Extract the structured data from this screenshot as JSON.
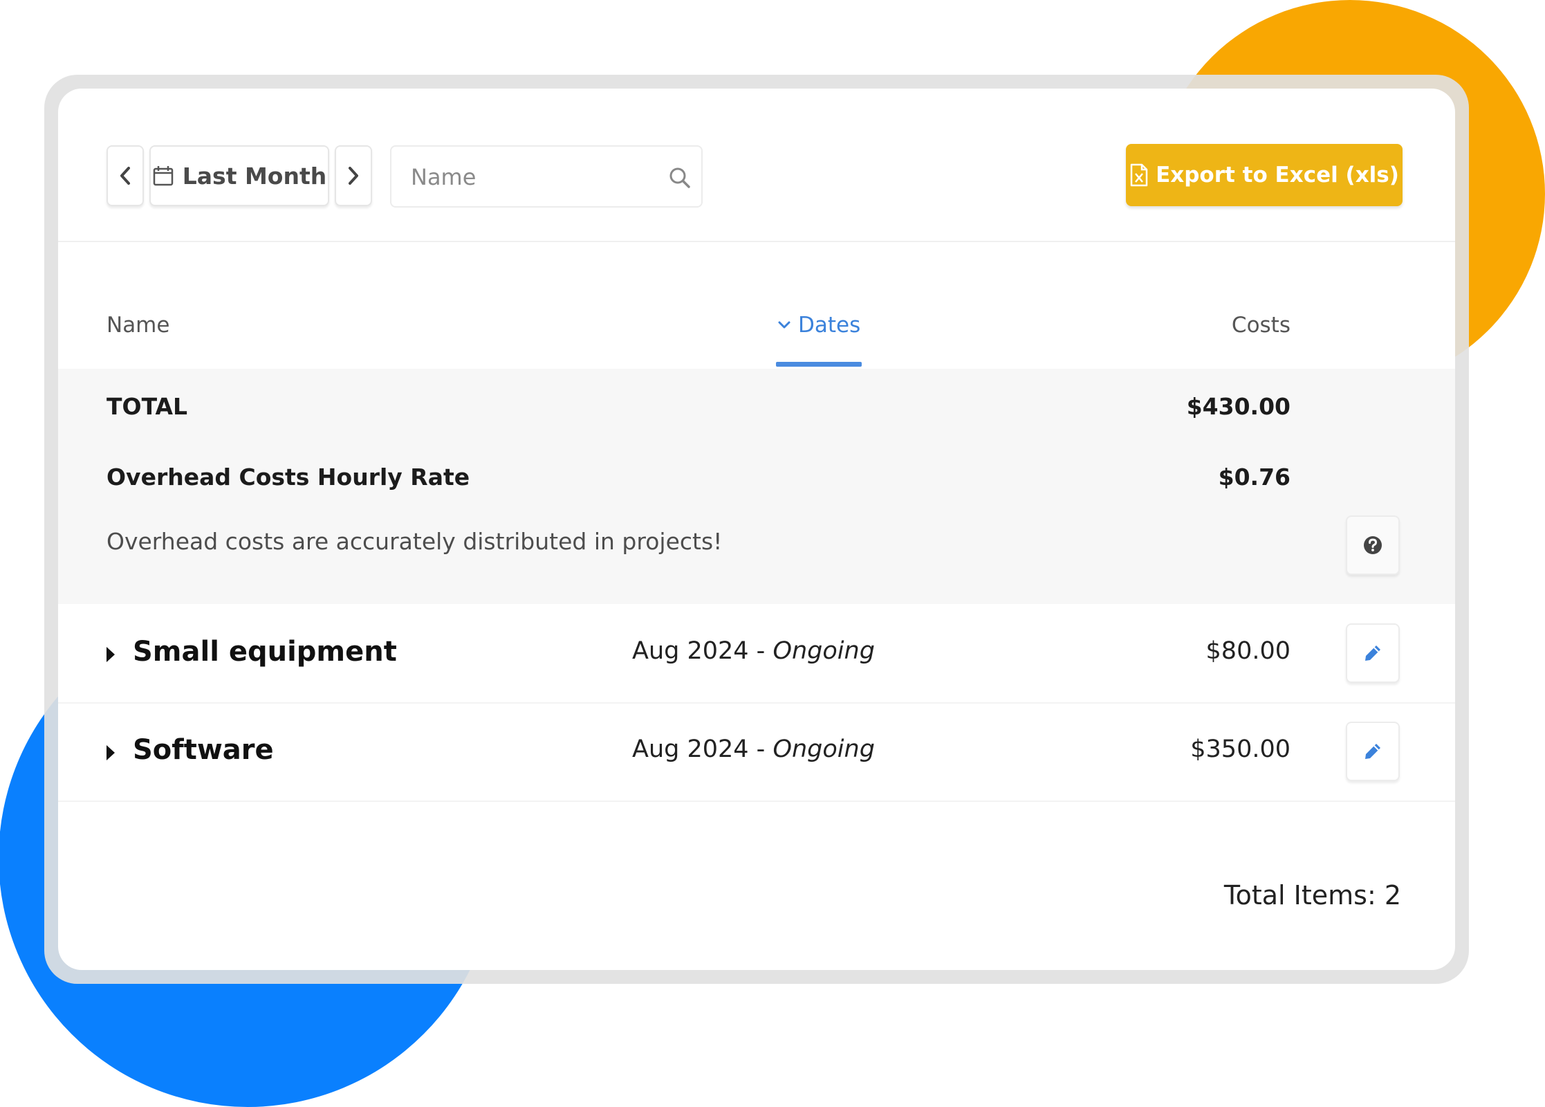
{
  "colors": {
    "accent_orange": "#F9A702",
    "accent_blue": "#0A80FE",
    "export_button": "#EEB516",
    "active_tab": "#3B82DB"
  },
  "toolbar": {
    "prev_icon": "chevron-left-icon",
    "period_icon": "calendar-icon",
    "period_label": "Last Month",
    "next_icon": "chevron-right-icon",
    "search_placeholder": "Name",
    "search_icon": "search-icon",
    "export_icon": "excel-file-icon",
    "export_label": "Export to Excel (xls)"
  },
  "table": {
    "columns": [
      {
        "label": "Name"
      },
      {
        "label": "Dates",
        "active": true,
        "sort_icon": "chevron-down-icon"
      },
      {
        "label": "Costs"
      }
    ],
    "summary": {
      "total_label": "TOTAL",
      "total_value": "$430.00",
      "rate_label": "Overhead Costs Hourly Rate",
      "rate_value": "$0.76",
      "info_text": "Overhead costs are accurately distributed in projects!",
      "help_icon": "question-circle-icon"
    },
    "rows": [
      {
        "name": "Small equipment",
        "start": "Aug 2024",
        "separator": " - ",
        "end": "Ongoing",
        "cost": "$80.00",
        "edit_icon": "pencil-icon"
      },
      {
        "name": "Software",
        "start": "Aug 2024",
        "separator": " - ",
        "end": "Ongoing",
        "cost": "$350.00",
        "edit_icon": "pencil-icon"
      }
    ]
  },
  "footer": {
    "total_items": "Total Items: 2"
  }
}
